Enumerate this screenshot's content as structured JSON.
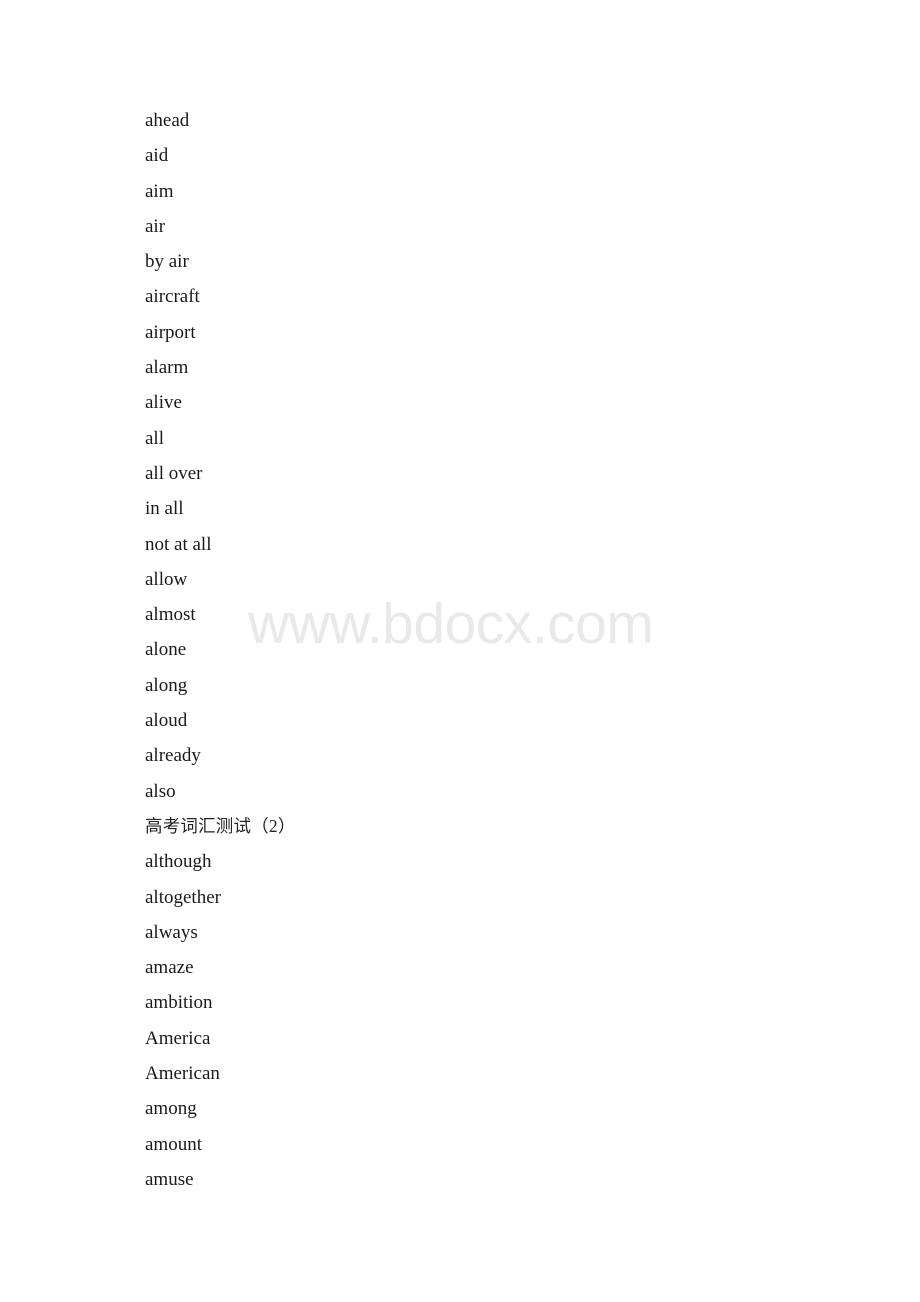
{
  "document": {
    "watermark": "www.bdocx.com",
    "section_heading": "高考词汇测试（2）",
    "entries": [
      {
        "text": "ahead",
        "lang": "en"
      },
      {
        "text": "aid",
        "lang": "en"
      },
      {
        "text": "aim",
        "lang": "en"
      },
      {
        "text": "air",
        "lang": "en"
      },
      {
        "text": "by air",
        "lang": "en"
      },
      {
        "text": "aircraft",
        "lang": "en"
      },
      {
        "text": "airport",
        "lang": "en"
      },
      {
        "text": "alarm",
        "lang": "en"
      },
      {
        "text": "alive",
        "lang": "en"
      },
      {
        "text": "all",
        "lang": "en"
      },
      {
        "text": "all over",
        "lang": "en"
      },
      {
        "text": "in all",
        "lang": "en"
      },
      {
        "text": "not at all",
        "lang": "en"
      },
      {
        "text": "allow",
        "lang": "en"
      },
      {
        "text": "almost",
        "lang": "en"
      },
      {
        "text": "alone",
        "lang": "en"
      },
      {
        "text": "along",
        "lang": "en"
      },
      {
        "text": "aloud",
        "lang": "en"
      },
      {
        "text": "already",
        "lang": "en"
      },
      {
        "text": "also",
        "lang": "en"
      },
      {
        "text": "高考词汇测试（2）",
        "lang": "zh"
      },
      {
        "text": "although",
        "lang": "en"
      },
      {
        "text": "altogether",
        "lang": "en"
      },
      {
        "text": "always",
        "lang": "en"
      },
      {
        "text": "amaze",
        "lang": "en"
      },
      {
        "text": "ambition",
        "lang": "en"
      },
      {
        "text": "America",
        "lang": "en"
      },
      {
        "text": "American",
        "lang": "en"
      },
      {
        "text": "among",
        "lang": "en"
      },
      {
        "text": "amount",
        "lang": "en"
      },
      {
        "text": "amuse",
        "lang": "en"
      }
    ]
  }
}
